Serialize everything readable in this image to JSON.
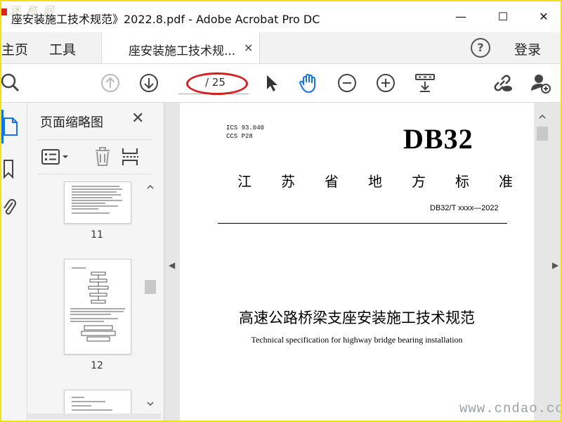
{
  "window": {
    "title": "座安装施工技术规范》2022.8.pdf - Adobe Acrobat Pro DC",
    "ghost_logo_text": "迷 称 网",
    "minimize": "—",
    "maximize": "☐",
    "close": "✕"
  },
  "tabs": {
    "home": "主页",
    "tools": "工具",
    "document_tab": "座安装施工技术规...",
    "document_tab_close": "×",
    "help": "?",
    "login": "登录"
  },
  "toolbar": {
    "page_indicator": "/ 25",
    "icons": [
      "search-icon",
      "page-up-icon",
      "page-down-icon",
      "select-cursor-icon",
      "hand-tool-icon",
      "zoom-out-icon",
      "zoom-in-icon",
      "scroll-mode-icon",
      "share-link-icon",
      "add-user-icon"
    ],
    "accent_color": "#1473e6",
    "highlight_color": "#d42020"
  },
  "sidebar": {
    "title": "页面缩略图",
    "close": "✕",
    "thumbnails": [
      {
        "label": "11"
      },
      {
        "label": "12"
      },
      {
        "label": ""
      }
    ]
  },
  "document": {
    "ics_code": "ICS 93.040\nCCS P28",
    "db_label": "DB32",
    "province_standard": "江苏省地方标准",
    "standard_number": "DB32/T xxxx—2022",
    "title_cn": "高速公路桥梁支座安装施工技术规范",
    "title_en": "Technical specification for highway bridge bearing installation"
  },
  "watermark": "www.cndao.com",
  "frame_color": "#f2e11a"
}
